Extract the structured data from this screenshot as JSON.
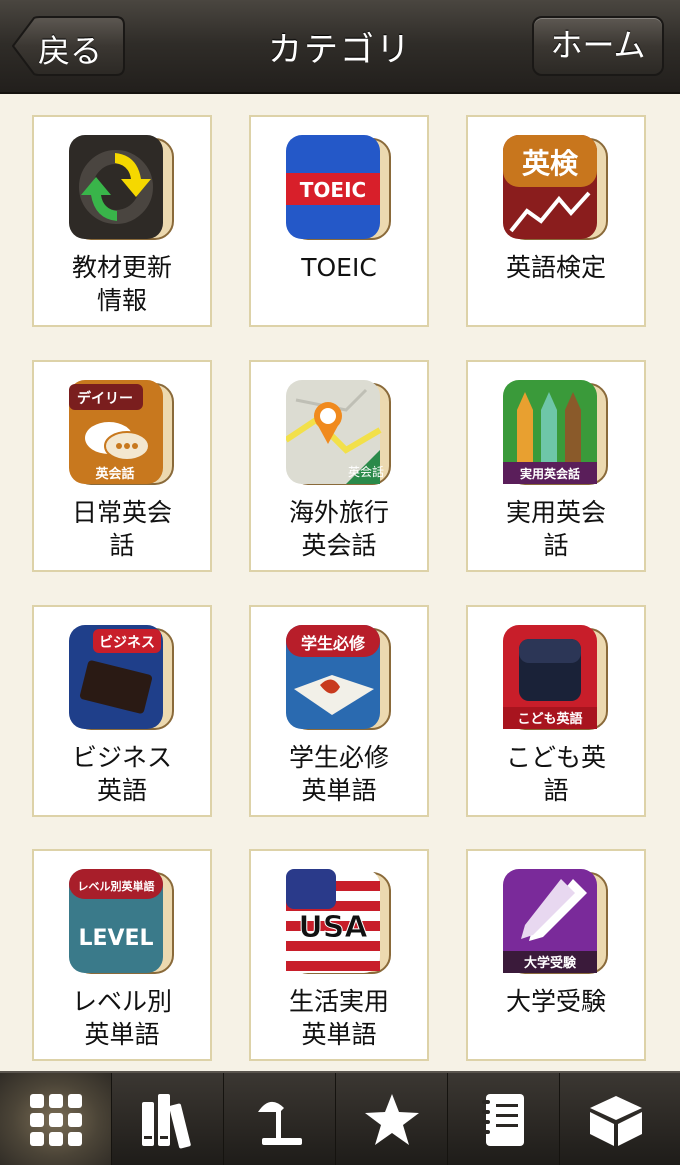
{
  "navbar": {
    "title": "カテゴリ",
    "back_label": "戻る",
    "home_label": "ホーム"
  },
  "categories": [
    {
      "label": "教材更新\n情報",
      "icon": "update-icon"
    },
    {
      "label": "TOEIC",
      "icon": "toeic-book-icon",
      "icon_text": "TOEIC"
    },
    {
      "label": "英語検定",
      "icon": "eiken-book-icon",
      "icon_text": "英検"
    },
    {
      "label": "日常英会\n話",
      "icon": "daily-conversation-icon",
      "icon_text": "デイリー",
      "icon_text2": "英会話"
    },
    {
      "label": "海外旅行\n英会話",
      "icon": "travel-map-icon",
      "icon_text": "英会話"
    },
    {
      "label": "実用英会\n話",
      "icon": "practical-pencils-icon",
      "icon_text": "実用英会話"
    },
    {
      "label": "ビジネス\n英語",
      "icon": "business-notebook-icon",
      "icon_text": "ビジネス"
    },
    {
      "label": "学生必修\n英単語",
      "icon": "student-book-icon",
      "icon_text": "学生必修"
    },
    {
      "label": "こども英\n語",
      "icon": "kids-backpack-icon",
      "icon_text": "こども英語"
    },
    {
      "label": "レベル別\n英単語",
      "icon": "level-book-icon",
      "icon_text": "レベル別英単語",
      "icon_text2": "LEVEL"
    },
    {
      "label": "生活実用\n英単語",
      "icon": "usa-flag-icon",
      "icon_text": "USA"
    },
    {
      "label": "大学受験",
      "icon": "university-pen-icon",
      "icon_text": "大学受験"
    }
  ],
  "tabbar": {
    "tabs": [
      {
        "icon": "grid-icon",
        "active": true
      },
      {
        "icon": "books-icon",
        "active": false
      },
      {
        "icon": "desk-lamp-icon",
        "active": false
      },
      {
        "icon": "star-icon",
        "active": false
      },
      {
        "icon": "notebook-icon",
        "active": false
      },
      {
        "icon": "box-icon",
        "active": false
      }
    ]
  },
  "colors": {
    "background": "#f6f2e6",
    "cell_border": "#ddd2a8",
    "bar_dark": "#2a2723"
  }
}
